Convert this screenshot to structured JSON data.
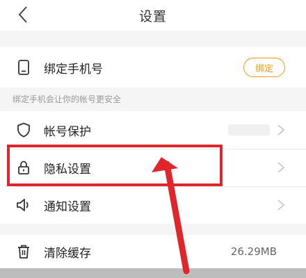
{
  "header": {
    "title": "设置"
  },
  "phone_section": {
    "label": "绑定手机号",
    "button": "绑定",
    "hint": "绑定手机会让你的帐号更安全"
  },
  "settings": [
    {
      "label": "帐号保护"
    },
    {
      "label": "隐私设置"
    },
    {
      "label": "通知设置"
    }
  ],
  "cache": {
    "label": "清除缓存",
    "value": "26.29MB"
  },
  "colors": {
    "accent": "#f39c12",
    "annotation": "#e0262b"
  }
}
